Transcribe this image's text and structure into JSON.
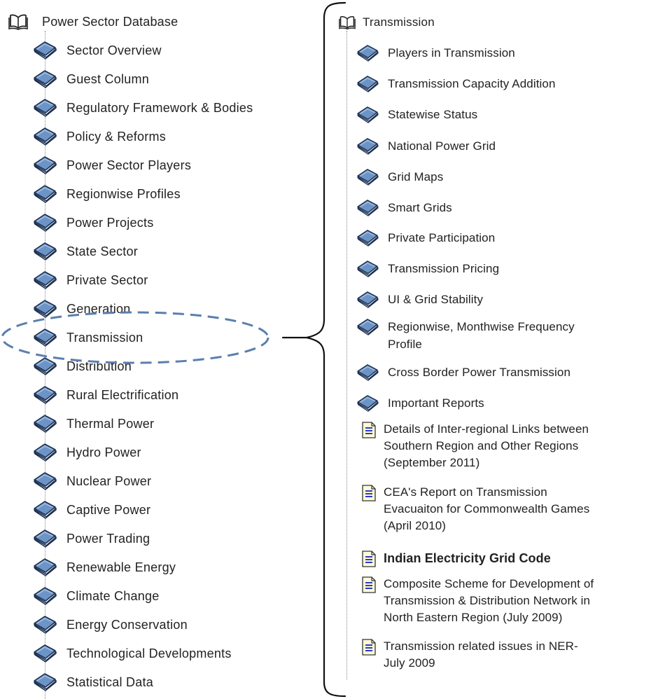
{
  "left_tree": {
    "root": {
      "label": "Power Sector Database",
      "icon": "open-book-icon"
    },
    "items": [
      {
        "label": "Sector Overview",
        "icon": "book-icon"
      },
      {
        "label": "Guest Column",
        "icon": "book-icon"
      },
      {
        "label": "Regulatory Framework & Bodies",
        "icon": "book-icon"
      },
      {
        "label": "Policy & Reforms",
        "icon": "book-icon"
      },
      {
        "label": "Power Sector Players",
        "icon": "book-icon"
      },
      {
        "label": "Regionwise Profiles",
        "icon": "book-icon"
      },
      {
        "label": "Power Projects",
        "icon": "book-icon"
      },
      {
        "label": "State Sector",
        "icon": "book-icon"
      },
      {
        "label": "Private Sector",
        "icon": "book-icon"
      },
      {
        "label": "Generation",
        "icon": "book-icon"
      },
      {
        "label": "Transmission",
        "icon": "book-icon",
        "highlighted": true
      },
      {
        "label": "Distribution",
        "icon": "book-icon"
      },
      {
        "label": "Rural Electrification",
        "icon": "book-icon"
      },
      {
        "label": "Thermal Power",
        "icon": "book-icon"
      },
      {
        "label": "Hydro Power",
        "icon": "book-icon"
      },
      {
        "label": "Nuclear Power",
        "icon": "book-icon"
      },
      {
        "label": "Captive Power",
        "icon": "book-icon"
      },
      {
        "label": "Power Trading",
        "icon": "book-icon"
      },
      {
        "label": "Renewable Energy",
        "icon": "book-icon"
      },
      {
        "label": "Climate Change",
        "icon": "book-icon"
      },
      {
        "label": "Energy Conservation",
        "icon": "book-icon"
      },
      {
        "label": "Technological Developments",
        "icon": "book-icon"
      },
      {
        "label": "Statistical Data",
        "icon": "book-icon"
      }
    ]
  },
  "right_tree": {
    "root": {
      "label": "Transmission",
      "icon": "open-book-icon"
    },
    "books": [
      {
        "label": "Players in Transmission",
        "icon": "book-icon"
      },
      {
        "label": "Transmission Capacity Addition",
        "icon": "book-icon"
      },
      {
        "label": "Statewise Status",
        "icon": "book-icon"
      },
      {
        "label": "National Power Grid",
        "icon": "book-icon"
      },
      {
        "label": "Grid Maps",
        "icon": "book-icon"
      },
      {
        "label": "Smart Grids",
        "icon": "book-icon"
      },
      {
        "label": "Private Participation",
        "icon": "book-icon"
      },
      {
        "label": "Transmission Pricing",
        "icon": "book-icon"
      },
      {
        "label": "UI & Grid Stability",
        "icon": "book-icon"
      },
      {
        "label": "Regionwise, Monthwise Frequency\nProfile",
        "icon": "book-icon"
      },
      {
        "label": "Cross Border Power Transmission",
        "icon": "book-icon"
      },
      {
        "label": "Important Reports",
        "icon": "book-icon"
      }
    ],
    "documents": [
      {
        "label": "Details of Inter-regional Links between\nSouthern Region and Other Regions\n(September 2011)",
        "icon": "document-icon"
      },
      {
        "label": "CEA's Report on Transmission\nEvacuaiton for Commonwealth Games\n(April 2010)",
        "icon": "document-icon"
      },
      {
        "label": "Indian Electricity Grid Code",
        "icon": "document-icon",
        "bold": true
      },
      {
        "label": "Composite Scheme for Development of\nTransmission & Distribution Network in\nNorth Eastern Region (July 2009)",
        "icon": "document-icon"
      },
      {
        "label": "Transmission related issues in NER-\nJuly 2009",
        "icon": "document-icon"
      }
    ]
  },
  "colors": {
    "book_blue": "#5f88bd",
    "book_dark": "#26466f",
    "highlight_dash": "#5a7fae",
    "doc_line": "#2a3cc8",
    "doc_paper": "#fffbd6"
  }
}
